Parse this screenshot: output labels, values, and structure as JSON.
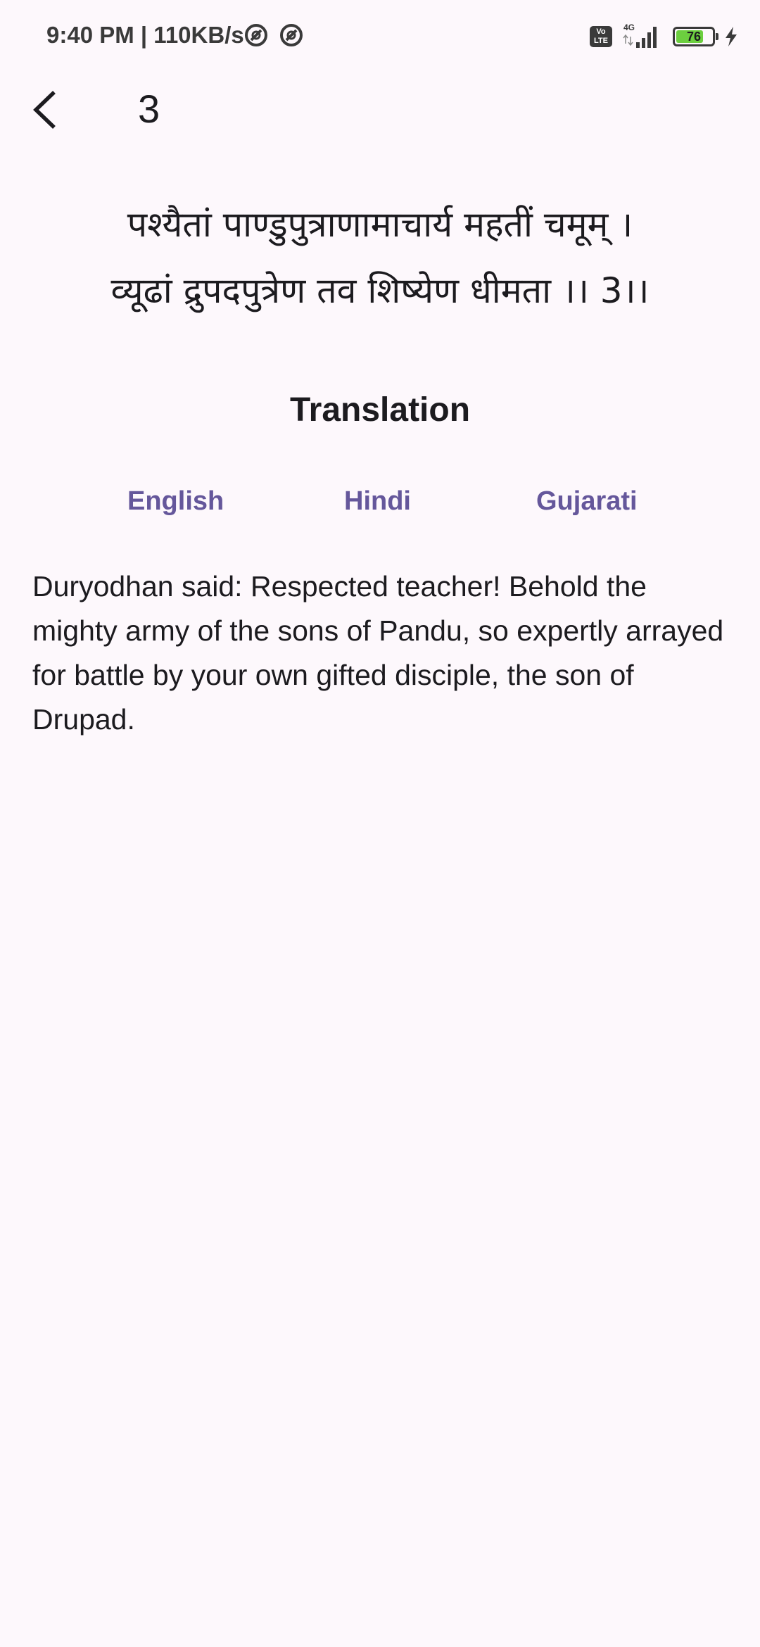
{
  "status_bar": {
    "time": "9:40 PM | 110KB/s",
    "volte_label": "Vo LTE",
    "network_label": "4G",
    "battery_level": "76",
    "battery_fraction": 0.76
  },
  "app_bar": {
    "back_icon": "chevron-left-icon",
    "title": "3"
  },
  "verse": {
    "line1": "पश्यैतां पाण्डुपुत्राणामाचार्य महतीं चमूम् ।",
    "line2": "व्यूढां द्रुपदपुत्रेण तव शिष्येण धीमता ।। 3।।"
  },
  "translation": {
    "heading": "Translation",
    "tabs": [
      {
        "label": "English"
      },
      {
        "label": "Hindi"
      },
      {
        "label": "Gujarati"
      }
    ],
    "text": "Duryodhan said: Respected teacher! Behold the mighty army of the sons of Pandu, so expertly arrayed for battle by your own gifted disciple, the son of Drupad."
  },
  "colors": {
    "background": "#fdf8fc",
    "accent": "#65579b",
    "text": "#1c1b1f",
    "battery": "#6ccf3f"
  }
}
